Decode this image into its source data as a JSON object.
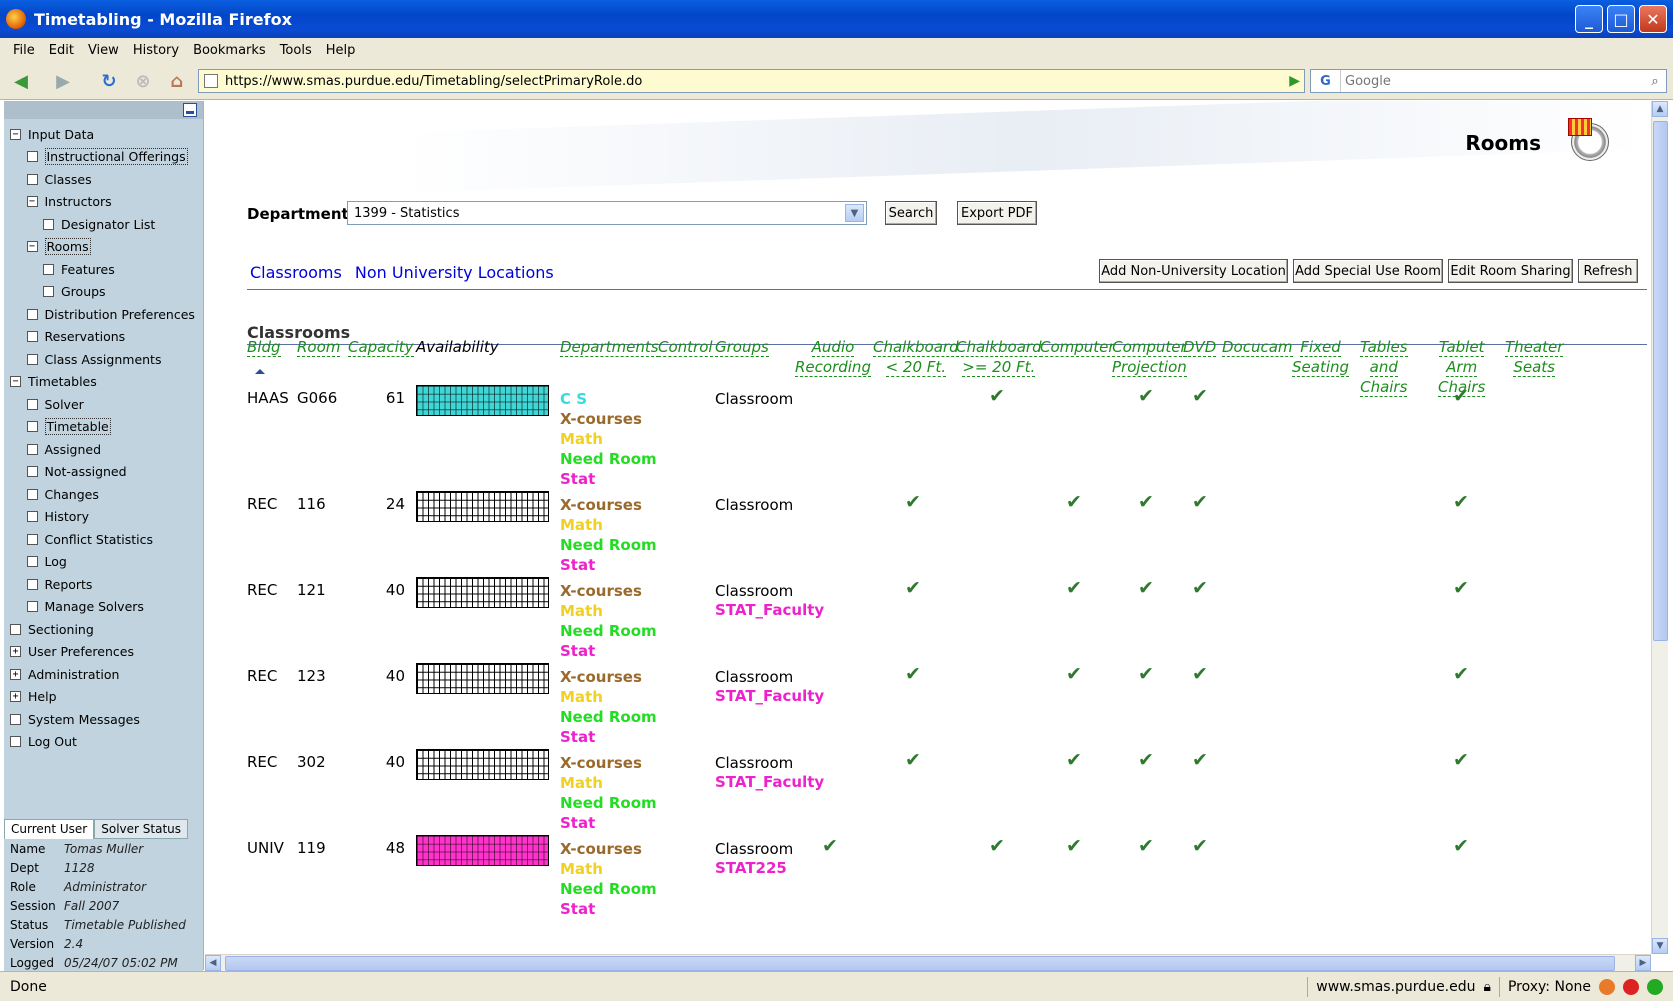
{
  "window": {
    "title": "Timetabling - Mozilla Firefox"
  },
  "menu": [
    "File",
    "Edit",
    "View",
    "History",
    "Bookmarks",
    "Tools",
    "Help"
  ],
  "nav": {
    "url": "https://www.smas.purdue.edu/Timetabling/selectPrimaryRole.do",
    "search_placeholder": "Google"
  },
  "sidebar": {
    "items": [
      {
        "label": "Input Data",
        "level": 0,
        "box": "−"
      },
      {
        "label": "Instructional Offerings",
        "level": 1,
        "box": " ",
        "sel": true
      },
      {
        "label": "Classes",
        "level": 1,
        "box": " "
      },
      {
        "label": "Instructors",
        "level": 1,
        "box": "−"
      },
      {
        "label": "Designator List",
        "level": 2,
        "box": " "
      },
      {
        "label": "Rooms",
        "level": 1,
        "box": "−",
        "sel": true
      },
      {
        "label": "Features",
        "level": 2,
        "box": " "
      },
      {
        "label": "Groups",
        "level": 2,
        "box": " "
      },
      {
        "label": "Distribution Preferences",
        "level": 1,
        "box": " "
      },
      {
        "label": "Reservations",
        "level": 1,
        "box": " "
      },
      {
        "label": "Class Assignments",
        "level": 1,
        "box": " "
      },
      {
        "label": "Timetables",
        "level": 0,
        "box": "−"
      },
      {
        "label": "Solver",
        "level": 1,
        "box": " "
      },
      {
        "label": "Timetable",
        "level": 1,
        "box": " ",
        "sel": true
      },
      {
        "label": "Assigned",
        "level": 1,
        "box": " "
      },
      {
        "label": "Not-assigned",
        "level": 1,
        "box": " "
      },
      {
        "label": "Changes",
        "level": 1,
        "box": " "
      },
      {
        "label": "History",
        "level": 1,
        "box": " "
      },
      {
        "label": "Conflict Statistics",
        "level": 1,
        "box": " "
      },
      {
        "label": "Log",
        "level": 1,
        "box": " "
      },
      {
        "label": "Reports",
        "level": 1,
        "box": " "
      },
      {
        "label": "Manage Solvers",
        "level": 1,
        "box": " "
      },
      {
        "label": "Sectioning",
        "level": 0,
        "box": " "
      },
      {
        "label": "User Preferences",
        "level": 0,
        "box": "+"
      },
      {
        "label": "Administration",
        "level": 0,
        "box": "+"
      },
      {
        "label": "Help",
        "level": 0,
        "box": "+"
      },
      {
        "label": "System Messages",
        "level": 0,
        "box": " "
      },
      {
        "label": "Log Out",
        "level": 0,
        "box": " "
      }
    ],
    "tabs": [
      "Current User",
      "Solver Status"
    ],
    "user_info": [
      {
        "k": "Name",
        "v": "Tomas Muller"
      },
      {
        "k": "Dept",
        "v": "1128"
      },
      {
        "k": "Role",
        "v": "Administrator"
      },
      {
        "k": "Session",
        "v": "Fall 2007"
      },
      {
        "k": "Status",
        "v": "Timetable Published"
      },
      {
        "k": "Version",
        "v": "2.4"
      },
      {
        "k": "Logged",
        "v": "05/24/07 05:02 PM"
      }
    ]
  },
  "main": {
    "title": "Rooms",
    "department_label": "Department:",
    "department_value": "1399 - Statistics",
    "search_btn": "Search",
    "export_btn": "Export PDF",
    "tabs": [
      "Classrooms",
      "Non University Locations"
    ],
    "actions": [
      "Add Non-University Location",
      "Add Special Use Room",
      "Edit Room Sharing",
      "Refresh"
    ],
    "section": "Classrooms",
    "columns": {
      "bldg": "Bldg",
      "room": "Room",
      "capacity": "Capacity",
      "availability": "Availability",
      "departments": "Departments",
      "control": "Control",
      "groups": "Groups",
      "features": [
        [
          "Audio",
          "Recording"
        ],
        [
          "Chalkboard",
          "< 20 Ft."
        ],
        [
          "Chalkboard",
          ">= 20 Ft."
        ],
        [
          "Computer"
        ],
        [
          "Computer",
          "Projection"
        ],
        [
          "DVD"
        ],
        [
          "Docucam"
        ],
        [
          "Fixed",
          "Seating"
        ],
        [
          "Tables",
          "and",
          "Chairs"
        ],
        [
          "Tablet",
          "Arm",
          "Chairs"
        ],
        [
          "Theater",
          "Seats"
        ]
      ]
    },
    "rows": [
      {
        "bldg": "HAAS",
        "room": "G066",
        "cap": "61",
        "avail": "cyan",
        "depts": [
          {
            "t": "C S",
            "c": "#33dddd"
          },
          {
            "t": "X-courses",
            "c": "#9a6a2a"
          },
          {
            "t": "Math",
            "c": "#f0d020"
          },
          {
            "t": "Need Room",
            "c": "#22dd22"
          },
          {
            "t": "Stat",
            "c": "#ee22cc"
          }
        ],
        "groups": [
          {
            "t": "Classroom",
            "c": "#000"
          }
        ],
        "checks": [
          2,
          4,
          5,
          9
        ]
      },
      {
        "bldg": "REC",
        "room": "116",
        "cap": "24",
        "avail": "white",
        "depts": [
          {
            "t": "X-courses",
            "c": "#9a6a2a"
          },
          {
            "t": "Math",
            "c": "#f0d020"
          },
          {
            "t": "Need Room",
            "c": "#22dd22"
          },
          {
            "t": "Stat",
            "c": "#ee22cc"
          }
        ],
        "groups": [
          {
            "t": "Classroom",
            "c": "#000"
          }
        ],
        "checks": [
          1,
          3,
          4,
          5,
          9
        ]
      },
      {
        "bldg": "REC",
        "room": "121",
        "cap": "40",
        "avail": "white",
        "depts": [
          {
            "t": "X-courses",
            "c": "#9a6a2a"
          },
          {
            "t": "Math",
            "c": "#f0d020"
          },
          {
            "t": "Need Room",
            "c": "#22dd22"
          },
          {
            "t": "Stat",
            "c": "#ee22cc"
          }
        ],
        "groups": [
          {
            "t": "Classroom",
            "c": "#000"
          },
          {
            "t": "STAT_Faculty",
            "c": "#ee22cc"
          }
        ],
        "checks": [
          1,
          3,
          4,
          5,
          9
        ]
      },
      {
        "bldg": "REC",
        "room": "123",
        "cap": "40",
        "avail": "white",
        "depts": [
          {
            "t": "X-courses",
            "c": "#9a6a2a"
          },
          {
            "t": "Math",
            "c": "#f0d020"
          },
          {
            "t": "Need Room",
            "c": "#22dd22"
          },
          {
            "t": "Stat",
            "c": "#ee22cc"
          }
        ],
        "groups": [
          {
            "t": "Classroom",
            "c": "#000"
          },
          {
            "t": "STAT_Faculty",
            "c": "#ee22cc"
          }
        ],
        "checks": [
          1,
          3,
          4,
          5,
          9
        ]
      },
      {
        "bldg": "REC",
        "room": "302",
        "cap": "40",
        "avail": "white",
        "depts": [
          {
            "t": "X-courses",
            "c": "#9a6a2a"
          },
          {
            "t": "Math",
            "c": "#f0d020"
          },
          {
            "t": "Need Room",
            "c": "#22dd22"
          },
          {
            "t": "Stat",
            "c": "#ee22cc"
          }
        ],
        "groups": [
          {
            "t": "Classroom",
            "c": "#000"
          },
          {
            "t": "STAT_Faculty",
            "c": "#ee22cc"
          }
        ],
        "checks": [
          1,
          3,
          4,
          5,
          9
        ]
      },
      {
        "bldg": "UNIV",
        "room": "119",
        "cap": "48",
        "avail": "magenta",
        "depts": [
          {
            "t": "X-courses",
            "c": "#9a6a2a"
          },
          {
            "t": "Math",
            "c": "#f0d020"
          },
          {
            "t": "Need Room",
            "c": "#22dd22"
          },
          {
            "t": "Stat",
            "c": "#ee22cc"
          }
        ],
        "groups": [
          {
            "t": "Classroom",
            "c": "#000"
          },
          {
            "t": "STAT225",
            "c": "#ee22cc"
          }
        ],
        "checks": [
          0,
          2,
          3,
          4,
          5,
          9
        ]
      }
    ]
  },
  "status": {
    "text": "Done",
    "host": "www.smas.purdue.edu",
    "proxy": "Proxy: None"
  }
}
